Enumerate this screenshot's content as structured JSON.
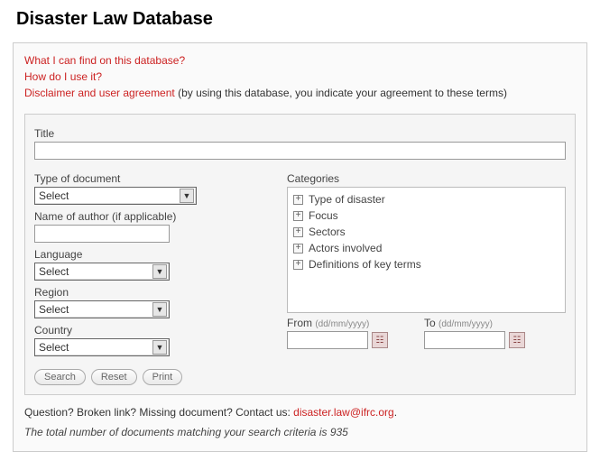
{
  "page_title": "Disaster Law Database",
  "links": {
    "what": "What I can find on this database?",
    "how": "How do I use it?",
    "disclaimer": "Disclaimer and user agreement",
    "disclaimer_suffix": " (by using this database, you indicate your agreement to these terms)"
  },
  "form": {
    "title_label": "Title",
    "title_value": "",
    "type_label": "Type of document",
    "type_value": "Select",
    "author_label": "Name of author (if applicable)",
    "author_value": "",
    "language_label": "Language",
    "language_value": "Select",
    "region_label": "Region",
    "region_value": "Select",
    "country_label": "Country",
    "country_value": "Select",
    "categories_label": "Categories",
    "categories": {
      "0": "Type of disaster",
      "1": "Focus",
      "2": "Sectors",
      "3": "Actors involved",
      "4": "Definitions of key terms"
    },
    "from_label": "From ",
    "to_label": "To ",
    "date_hint": "(dd/mm/yyyy)",
    "from_value": "",
    "to_value": "",
    "buttons": {
      "search": "Search",
      "reset": "Reset",
      "print": "Print"
    }
  },
  "footer": {
    "question_prefix": "Question? Broken link? Missing document? Contact us: ",
    "contact": "disaster.law@ifrc.org",
    "period": ".",
    "result_prefix": "The total number of documents matching your search criteria is ",
    "result_count": "935"
  }
}
